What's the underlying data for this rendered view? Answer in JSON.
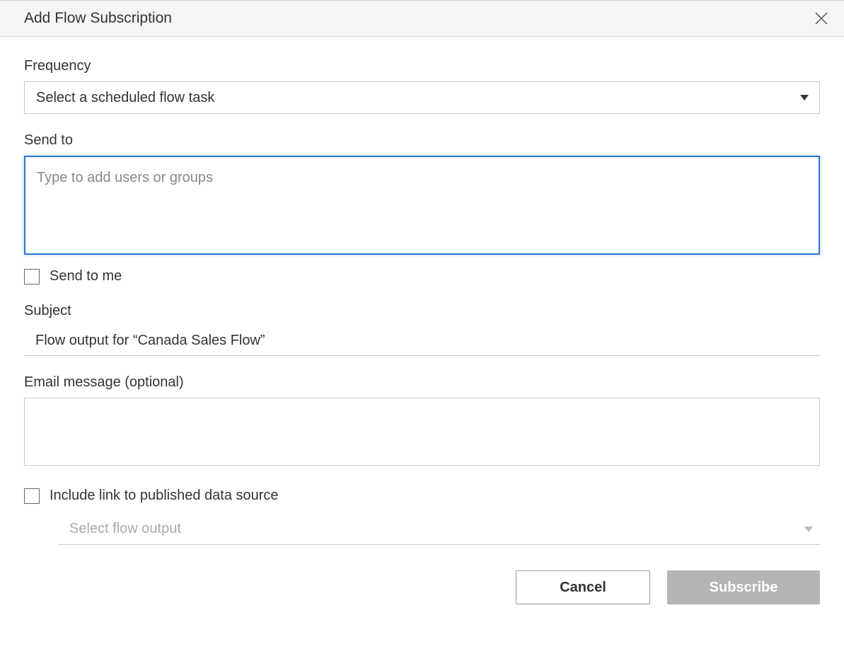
{
  "dialog": {
    "title": "Add Flow Subscription"
  },
  "frequency": {
    "label": "Frequency",
    "selected": "Select a scheduled flow task"
  },
  "sendto": {
    "label": "Send to",
    "placeholder": "Type to add users or groups",
    "value": "",
    "send_to_me_label": "Send to me"
  },
  "subject": {
    "label": "Subject",
    "value": "Flow output for “Canada Sales Flow”"
  },
  "email": {
    "label": "Email message (optional)",
    "value": ""
  },
  "include_link": {
    "label": "Include link to published data source",
    "flow_output_placeholder": "Select flow output"
  },
  "buttons": {
    "cancel": "Cancel",
    "subscribe": "Subscribe"
  }
}
